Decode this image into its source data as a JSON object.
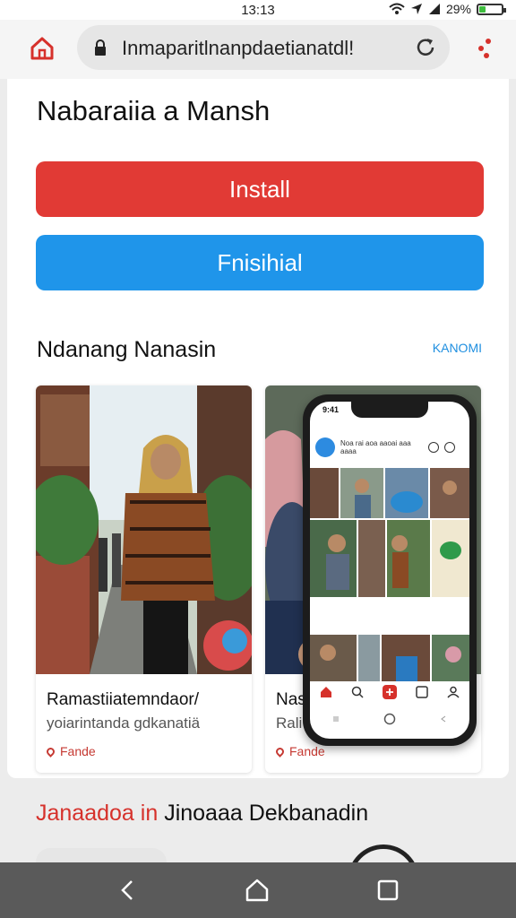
{
  "status_bar": {
    "time": "13:13",
    "battery": "29%",
    "battery_level": 0.29
  },
  "browser": {
    "url": "Inmaparitlnanpdaetianatdl!"
  },
  "page": {
    "app_title": "Nabaraiia a Mansh",
    "install_label": "Install",
    "second_label": "Fnisihial",
    "section_title": "Ndanang Nanasin",
    "section_link": "KANOMI",
    "cards": [
      {
        "title": "Ramastiiatemndaor/",
        "subtitle": "yoiarintanda gdkanatiä",
        "location": "Fande"
      },
      {
        "title": "Nas",
        "subtitle": "Rali",
        "location": "Fande"
      }
    ],
    "section2_red": "Janaadoa in",
    "section2_black": "Jinoaaa Dekbanadin"
  },
  "phone": {
    "time": "9:41",
    "app_name": "Noa rai aoa aaoai aaa aaaa"
  },
  "colors": {
    "install": "#e13a35",
    "secondary": "#1f95ea",
    "link": "#1f8fe0",
    "accent_red": "#d6312b"
  },
  "icons": [
    "home-icon",
    "lock-icon",
    "reload-icon",
    "menu-icon",
    "back-icon",
    "recents-icon"
  ]
}
